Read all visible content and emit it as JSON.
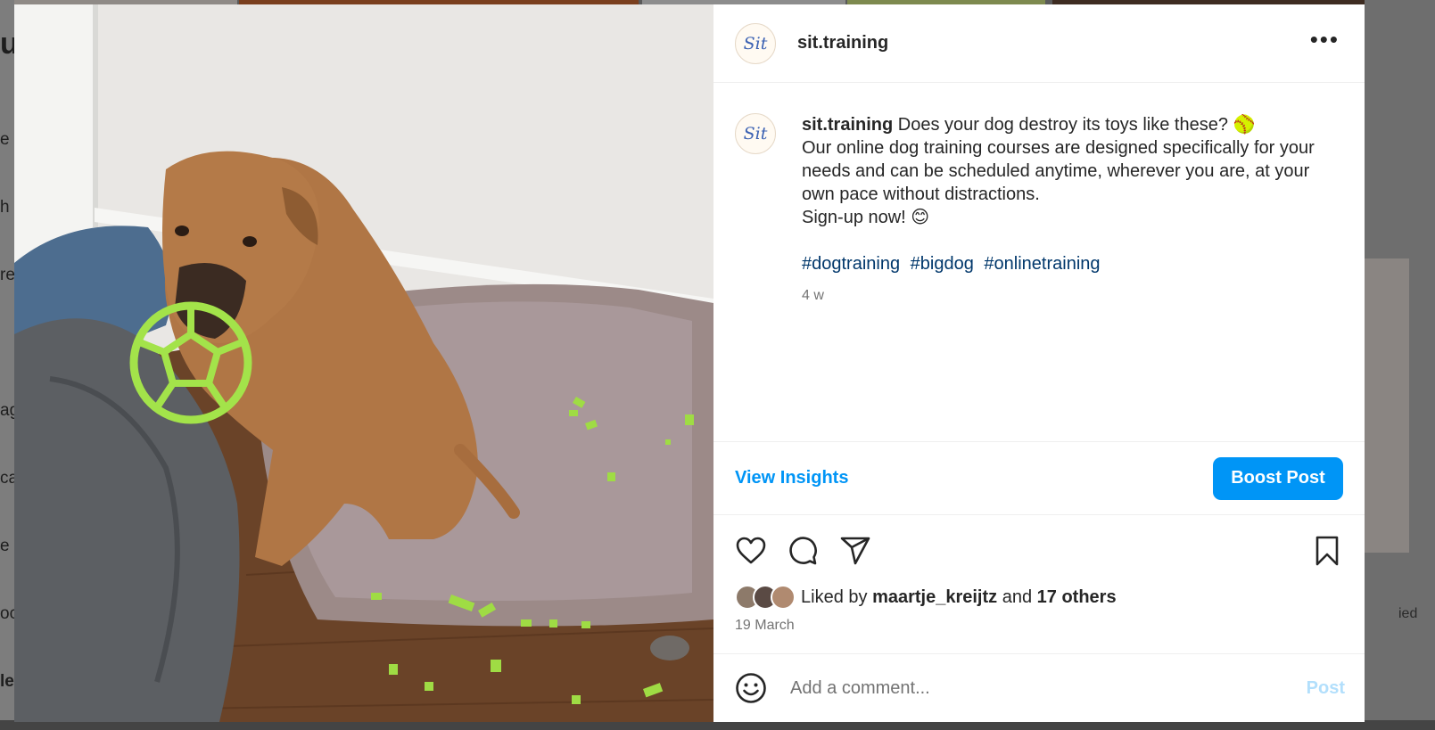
{
  "post": {
    "username": "sit.training",
    "avatar_text": "Sit",
    "more_icon": "more-horizontal-icon",
    "caption": {
      "username": "sit.training",
      "line1": "Does your dog destroy its toys like these? 🥎",
      "line2": "Our online dog training courses are designed specifically for your needs and can be scheduled anytime, wherever you are, at your own pace without distractions.",
      "line3": "Sign-up now! 😊",
      "hashtags": [
        "#dogtraining",
        "#bigdog",
        "#onlinetraining"
      ],
      "age": "4 w"
    },
    "insights_label": "View Insights",
    "boost_label": "Boost Post",
    "icons": [
      "heart-icon",
      "comment-icon",
      "share-icon",
      "bookmark-icon"
    ],
    "likes": {
      "prefix": "Liked by",
      "user": "maartje_kreijtz",
      "middle": "and",
      "others": "17 others"
    },
    "date": "19 March",
    "comment": {
      "placeholder": "Add a comment...",
      "post_label": "Post",
      "emoji_icon": "emoji-icon"
    }
  },
  "background": {
    "left_fragments": [
      "u",
      "e",
      "h",
      "re",
      "ag",
      "ca",
      "e",
      "oc",
      "le"
    ],
    "right_fragment": "ied"
  },
  "colors": {
    "accent": "#0095f6",
    "hashtag": "#00376b",
    "post_disabled": "#b2dffc",
    "toy_green": "#a3e34a"
  }
}
